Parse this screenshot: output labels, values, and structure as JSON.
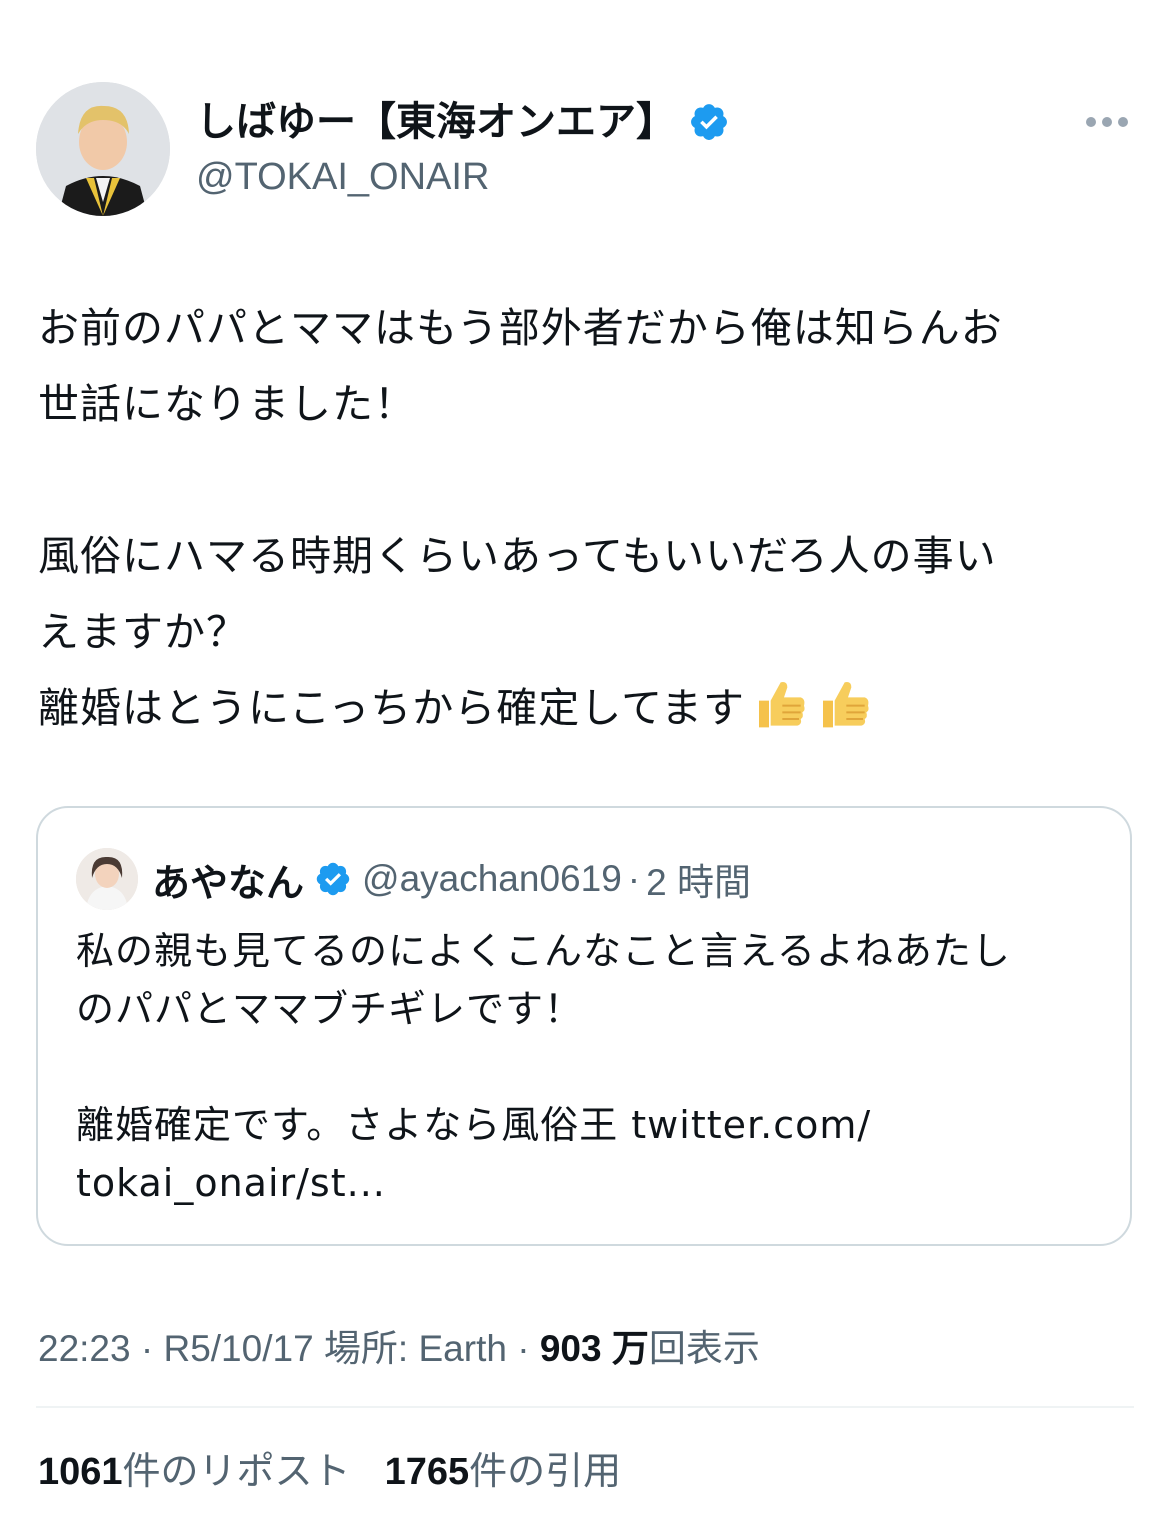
{
  "author": {
    "display_name": "しばゆー【東海オンエア】",
    "handle": "@TOKAI_ONAIR",
    "verified_color": "#1d9bf0"
  },
  "tweet": {
    "text": "お前のパパとママはもう部外者だから俺は知らんお\n世話になりました！\n\n風俗にハマる時期くらいあってもいいだろ人の事い\nえますか？\n離婚はとうにこっちから確定してます",
    "emoji": [
      "thumbs-up",
      "thumbs-up"
    ]
  },
  "quoted_tweet": {
    "display_name": "あやなん",
    "handle": "@ayachan0619",
    "separator": "·",
    "time": "2 時間",
    "text": "私の親も見てるのによくこんなこと言えるよねあたし\nのパパとママブチギレです！\n\n離婚確定です。さよなら風俗王 twitter.com/\ntokai_onair/st..."
  },
  "meta": {
    "time": "22:23",
    "sep1": " · ",
    "date": "R5/10/17",
    "location": " 場所: Earth",
    "sep2": " · ",
    "views_count": "903 万",
    "views_label": "回表示"
  },
  "stats": {
    "reposts_count": "1061",
    "reposts_label": "件のリポスト",
    "quotes_count": "1765",
    "quotes_label": "件の引用"
  }
}
